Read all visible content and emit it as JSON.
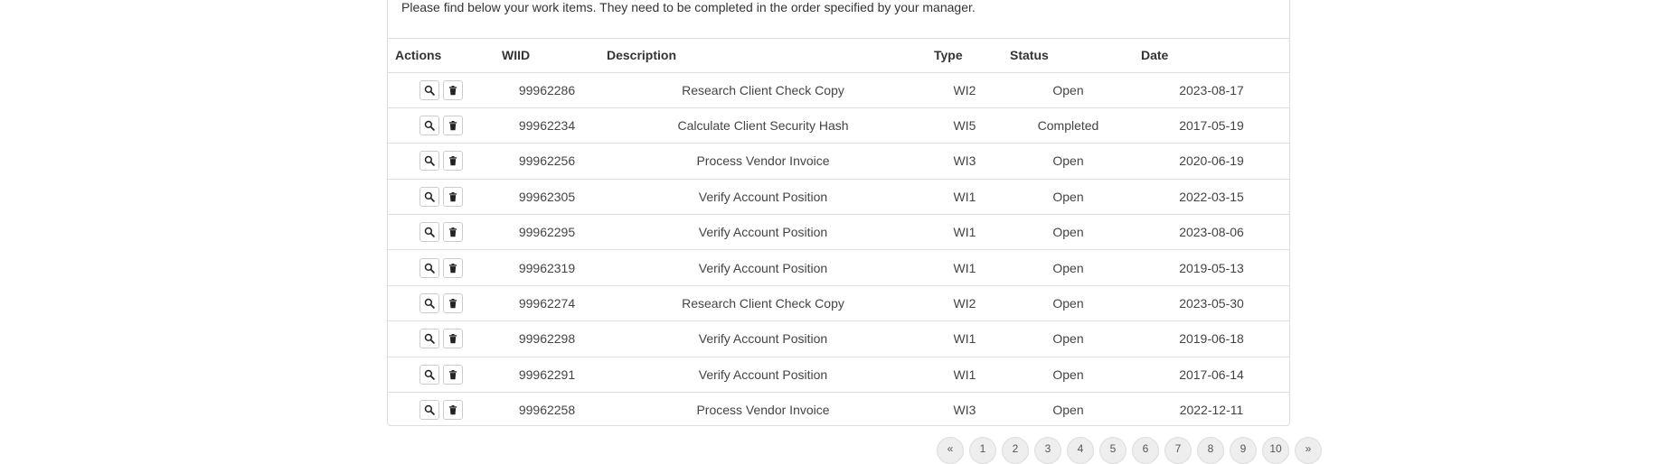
{
  "intro_text": "Please find below your work items. They need to be completed in the order specified by your manager.",
  "table": {
    "headers": {
      "actions": "Actions",
      "wiid": "WIID",
      "description": "Description",
      "type": "Type",
      "status": "Status",
      "date": "Date"
    },
    "rows": [
      {
        "wiid": "99962286",
        "description": "Research Client Check Copy",
        "type": "WI2",
        "status": "Open",
        "date": "2023-08-17"
      },
      {
        "wiid": "99962234",
        "description": "Calculate Client Security Hash",
        "type": "WI5",
        "status": "Completed",
        "date": "2017-05-19"
      },
      {
        "wiid": "99962256",
        "description": "Process Vendor Invoice",
        "type": "WI3",
        "status": "Open",
        "date": "2020-06-19"
      },
      {
        "wiid": "99962305",
        "description": "Verify Account Position",
        "type": "WI1",
        "status": "Open",
        "date": "2022-03-15"
      },
      {
        "wiid": "99962295",
        "description": "Verify Account Position",
        "type": "WI1",
        "status": "Open",
        "date": "2023-08-06"
      },
      {
        "wiid": "99962319",
        "description": "Verify Account Position",
        "type": "WI1",
        "status": "Open",
        "date": "2019-05-13"
      },
      {
        "wiid": "99962274",
        "description": "Research Client Check Copy",
        "type": "WI2",
        "status": "Open",
        "date": "2023-05-30"
      },
      {
        "wiid": "99962298",
        "description": "Verify Account Position",
        "type": "WI1",
        "status": "Open",
        "date": "2019-06-18"
      },
      {
        "wiid": "99962291",
        "description": "Verify Account Position",
        "type": "WI1",
        "status": "Open",
        "date": "2017-06-14"
      },
      {
        "wiid": "99962258",
        "description": "Process Vendor Invoice",
        "type": "WI3",
        "status": "Open",
        "date": "2022-12-11"
      }
    ]
  },
  "icons": {
    "view": "search-icon",
    "delete": "trash-icon"
  },
  "pagination": {
    "items": [
      "«",
      "1",
      "2",
      "3",
      "4",
      "5",
      "6",
      "7",
      "8",
      "9",
      "10",
      "»"
    ]
  }
}
